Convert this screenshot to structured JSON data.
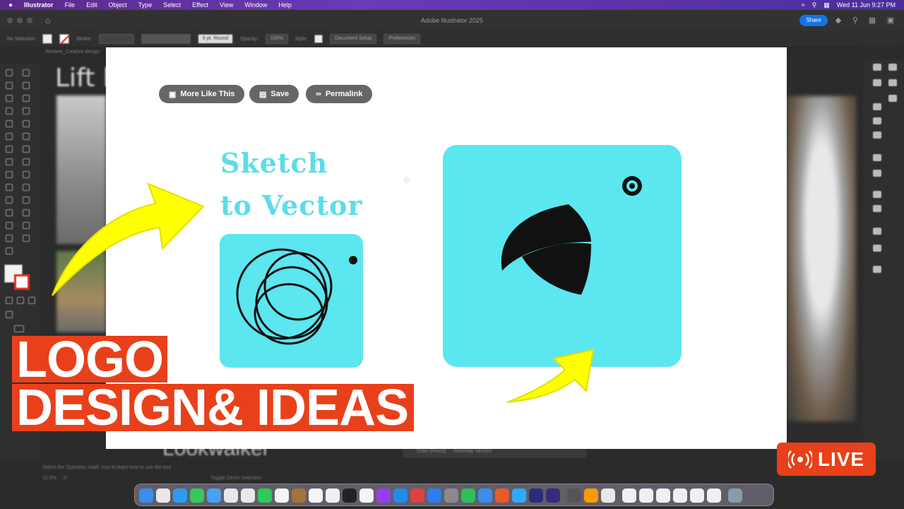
{
  "menubar": {
    "apple_icon": "apple-icon",
    "items": [
      "Illustrator",
      "File",
      "Edit",
      "Object",
      "Type",
      "Select",
      "Effect",
      "View",
      "Window",
      "Help"
    ],
    "datetime": "Wed 11 Jun 9:27 PM"
  },
  "app": {
    "title": "Adobe Illustrator 2025",
    "share_label": "Share"
  },
  "control_bar": {
    "selection": "No Selection",
    "stroke_label": "Stroke:",
    "brush": "5 pt. Round",
    "opacity_label": "Opacity:",
    "opacity_value": "100%",
    "style_label": "Style:",
    "document_setup": "Document Setup",
    "preferences": "Preferences"
  },
  "doc_tab": "Restore_Creative-design",
  "background": {
    "heading": "Lift b",
    "bottom_title": "Lookwalker",
    "bottom_bar_draw": "Draw (Pencil)",
    "bottom_bar_generate": "Generate Vectors",
    "status": "Select the 'Question mark' icon to learn how to use the tool",
    "zoom": "12.5%",
    "rotation": "0°",
    "toggle": "Toggle Direct Selection"
  },
  "card": {
    "buttons": [
      {
        "label": "More Like This",
        "icon": "image-icon"
      },
      {
        "label": "Save",
        "icon": "folder-icon"
      },
      {
        "label": "Permalink",
        "icon": "link-icon"
      }
    ],
    "title_line1": "Sketch",
    "title_line2": "to Vector"
  },
  "overlay": {
    "line1": "LOGO",
    "line2": "DESIGN& IDEAS",
    "live_label": "LIVE"
  },
  "colors": {
    "accent_cyan": "#5ce6ef",
    "overlay_orange": "#e8401a",
    "arrow_yellow": "#ffff00",
    "share_blue": "#1473e6"
  }
}
